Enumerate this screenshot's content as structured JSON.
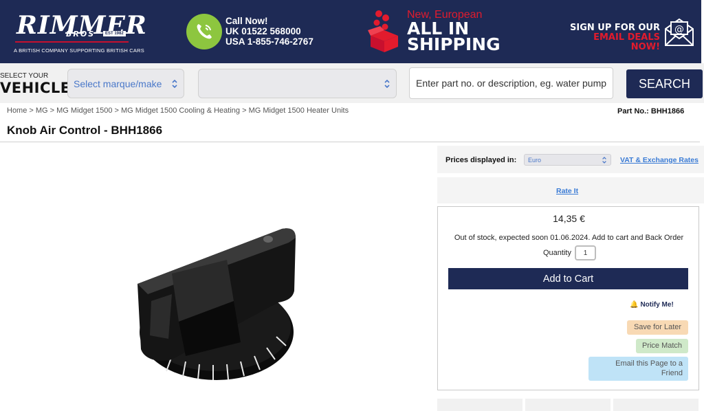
{
  "header": {
    "logo": {
      "name": "RIMMER",
      "sub": "BROS",
      "est": "EST 1982",
      "tagline": "A BRITISH COMPANY SUPPORTING BRITISH CARS"
    },
    "call": {
      "title": "Call Now!",
      "uk": "UK  01522 568000",
      "usa": "USA  1-855-746-2767"
    },
    "shipping": {
      "new": "New, European",
      "line1": "ALL IN",
      "line2": "SHIPPING"
    },
    "signup": {
      "line1": "SIGN UP FOR OUR",
      "line2": "EMAIL DEALS NOW!"
    },
    "colors": {
      "navy": "#1e2a55",
      "red": "#e21b2d",
      "green": "#8dc63f"
    }
  },
  "vehicle_bar": {
    "select_your": "SELECT YOUR",
    "vehicle": "VEHICLE",
    "make_select": "Select marque/make",
    "model_select": "",
    "search_placeholder": "Enter part no. or description, eg. water pump",
    "search_button": "SEARCH"
  },
  "breadcrumb": "Home > MG > MG Midget 1500 > MG Midget 1500 Cooling & Heating > MG Midget 1500 Heater Units",
  "part_no": "Part No.: BHH1866",
  "title": "Knob Air Control - BHH1866",
  "pricing": {
    "prices_label": "Prices displayed in:",
    "currency": "Euro",
    "vat_link": "VAT & Exchange Rates",
    "rate_it": "Rate It",
    "price": "14,35 €",
    "stock": "Out of stock, expected soon 01.06.2024. Add to cart and Back Order",
    "quantity_label": "Quantity",
    "quantity_value": "1",
    "add_to_cart": "Add to Cart",
    "notify": "Notify Me!",
    "save_later": "Save for Later",
    "price_match": "Price Match",
    "email_friend_1": "Email this Page to a",
    "email_friend_2": "Friend"
  }
}
